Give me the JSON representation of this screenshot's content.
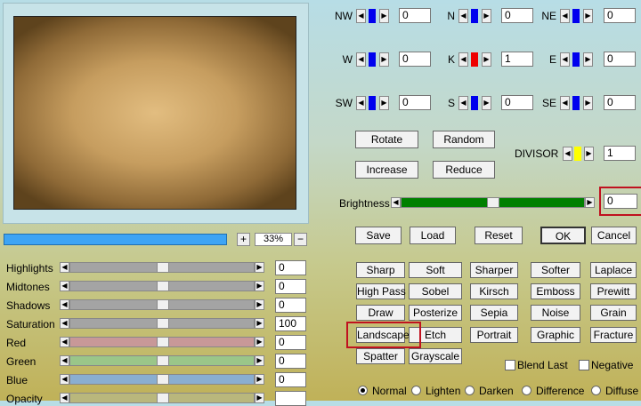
{
  "zoom": {
    "plus_label": "+",
    "minus_label": "−",
    "value": "33%"
  },
  "preview_progress": 1.0,
  "adjustments": [
    {
      "label": "Highlights",
      "value": "0",
      "track": "#a4a4a4"
    },
    {
      "label": "Midtones",
      "value": "0",
      "track": "#a4a4a4"
    },
    {
      "label": "Shadows",
      "value": "0",
      "track": "#a4a4a4"
    },
    {
      "label": "Saturation",
      "value": "100",
      "track": "#a4a4a4"
    },
    {
      "label": "Red",
      "value": "0",
      "track": "#c89898"
    },
    {
      "label": "Green",
      "value": "0",
      "track": "#9ac689"
    },
    {
      "label": "Blue",
      "value": "0",
      "track": "#8aaed0"
    },
    {
      "label": "Opacity",
      "value": "",
      "track": "#b9b77c"
    }
  ],
  "kernel": [
    {
      "label": "NW",
      "value": "0",
      "indicator": "#0000ee"
    },
    {
      "label": "N",
      "value": "0",
      "indicator": "#0000ee"
    },
    {
      "label": "NE",
      "value": "0",
      "indicator": "#0000ee"
    },
    {
      "label": "W",
      "value": "0",
      "indicator": "#0000ee"
    },
    {
      "label": "K",
      "value": "1",
      "indicator": "#ee0000"
    },
    {
      "label": "E",
      "value": "0",
      "indicator": "#0000ee"
    },
    {
      "label": "SW",
      "value": "0",
      "indicator": "#0000ee"
    },
    {
      "label": "S",
      "value": "0",
      "indicator": "#0000ee"
    },
    {
      "label": "SE",
      "value": "0",
      "indicator": "#0000ee"
    }
  ],
  "actions": {
    "rotate": "Rotate",
    "random": "Random",
    "increase": "Increase",
    "reduce": "Reduce"
  },
  "divisor": {
    "label": "DIVISOR",
    "value": "1",
    "indicator": "#ffff00"
  },
  "brightness": {
    "label": "Brightness",
    "value": "0",
    "track_color": "#008000"
  },
  "file_buttons": {
    "save": "Save",
    "load": "Load",
    "reset": "Reset",
    "ok": "OK",
    "cancel": "Cancel"
  },
  "presets": [
    [
      "Sharp",
      "Soft",
      "Sharper",
      "Softer",
      "Laplace"
    ],
    [
      "High Pass",
      "Sobel",
      "Kirsch",
      "Emboss",
      "Prewitt"
    ],
    [
      "Draw",
      "Posterize",
      "Sepia",
      "Noise",
      "Grain"
    ],
    [
      "Landscape",
      "Etch",
      "Portrait",
      "Graphic",
      "Fracture"
    ],
    [
      "Spatter",
      "Grayscale"
    ]
  ],
  "options": {
    "blend_last": "Blend Last",
    "negative": "Negative"
  },
  "blend_modes": [
    "Normal",
    "Lighten",
    "Darken",
    "Difference",
    "Diffuse"
  ],
  "blend_selected": "Normal",
  "colors": {
    "highlight": "#c0111f",
    "progress": "#3da4f4"
  }
}
